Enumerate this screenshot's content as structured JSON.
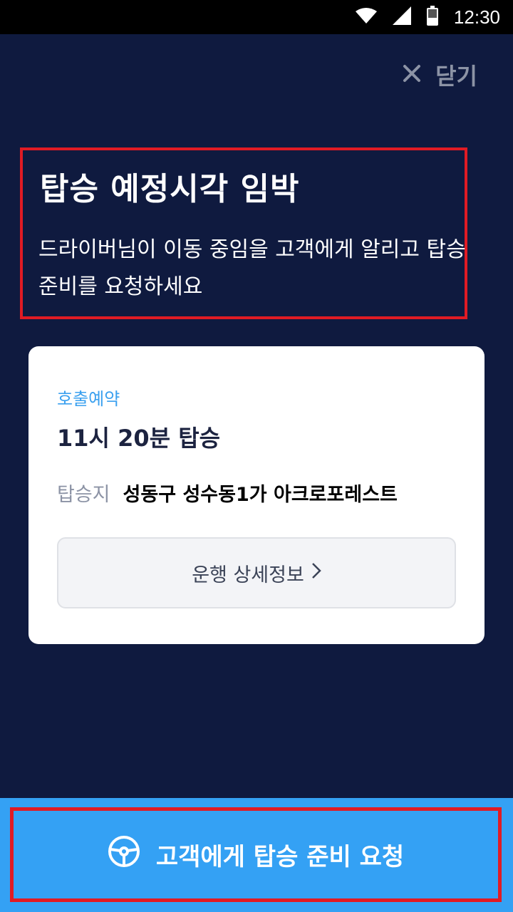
{
  "status_bar": {
    "time": "12:30",
    "icons": [
      "wifi-icon",
      "cell-signal-icon",
      "battery-icon"
    ]
  },
  "header": {
    "close_label": "닫기",
    "title": "탑승 예정시각 임박",
    "subtitle": "드라이버님이 이동 중임을 고객에게 알리고 탑승 준비를 요청하세요"
  },
  "card": {
    "tag": "호출예약",
    "pickup_time": "11시 20분 탑승",
    "pickup_label": "탑승지",
    "pickup_location": "성동구 성수동1가 아크로포레스트",
    "detail_button": "운행 상세정보"
  },
  "footer": {
    "request_button": "고객에게 탑승 준비 요청",
    "icon": "steering-wheel-icon"
  },
  "colors": {
    "background": "#0f1a3f",
    "accent": "#34a1f4",
    "tag": "#3aa0ef",
    "highlight_border": "#e01b24"
  }
}
